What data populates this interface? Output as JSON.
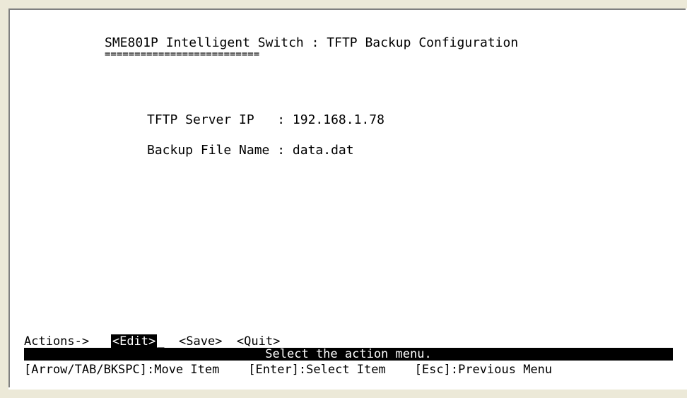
{
  "screen": {
    "title": "SME801P Intelligent Switch : TFTP Backup Configuration",
    "title_underline": "==========================",
    "fields": [
      {
        "label": "TFTP Server IP   : ",
        "value": "192.168.1.78"
      },
      {
        "label": "Backup File Name : ",
        "value": "data.dat"
      }
    ]
  },
  "actions": {
    "prefix": "Actions->",
    "edit": "<Edit>",
    "cursor": "_",
    "save": "<Save>",
    "quit": "<Quit>"
  },
  "status": "Select the action menu.",
  "help": "[Arrow/TAB/BKSPC]:Move Item    [Enter]:Select Item    [Esc]:Previous Menu"
}
